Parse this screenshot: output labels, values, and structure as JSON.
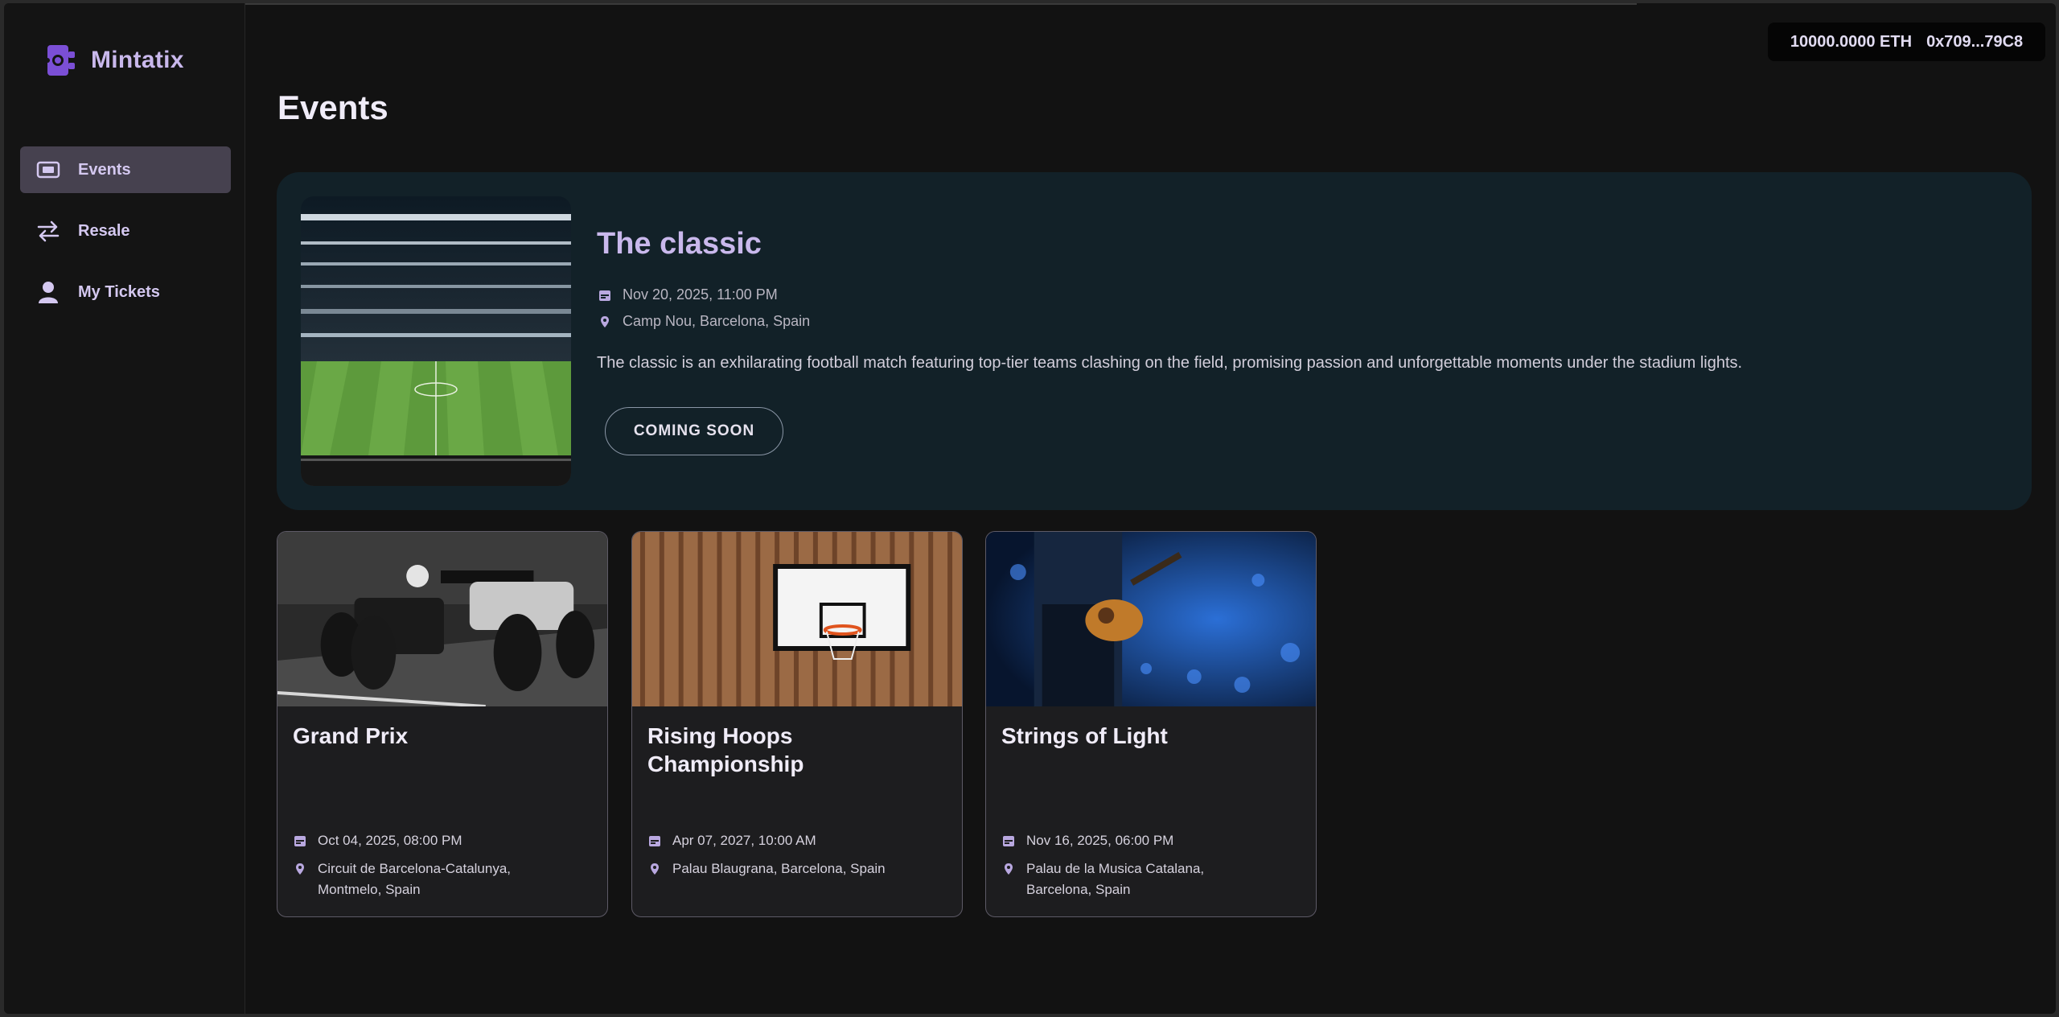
{
  "brand": {
    "name": "Mintatix"
  },
  "nav": [
    {
      "label": "Events",
      "icon": "ticket-icon",
      "active": true
    },
    {
      "label": "Resale",
      "icon": "swap-arrows-icon",
      "active": false
    },
    {
      "label": "My Tickets",
      "icon": "user-icon",
      "active": false
    }
  ],
  "wallet": {
    "balance": "10000.0000 ETH",
    "address": "0x709...79C8"
  },
  "page": {
    "title": "Events"
  },
  "featured": {
    "title": "The classic",
    "date": "Nov 20, 2025, 11:00 PM",
    "location": "Camp Nou, Barcelona, Spain",
    "description": "The classic is an exhilarating football match featuring top-tier teams clashing on the field, promising passion and unforgettable moments under the stadium lights.",
    "button": "COMING SOON"
  },
  "events": [
    {
      "title": "Grand Prix",
      "date": "Oct 04, 2025, 08:00 PM",
      "location": "Circuit de Barcelona-Catalunya, Montmelo, Spain"
    },
    {
      "title": "Rising Hoops Championship",
      "date": "Apr 07, 2027, 10:00 AM",
      "location": "Palau Blaugrana, Barcelona, Spain"
    },
    {
      "title": "Strings of Light",
      "date": "Nov 16, 2025, 06:00 PM",
      "location": "Palau de la Musica Catalana, Barcelona, Spain"
    }
  ],
  "colors": {
    "accent": "#c9b8ec",
    "brand_icon": "#7b4fd6",
    "featured_bg": "#122128"
  }
}
